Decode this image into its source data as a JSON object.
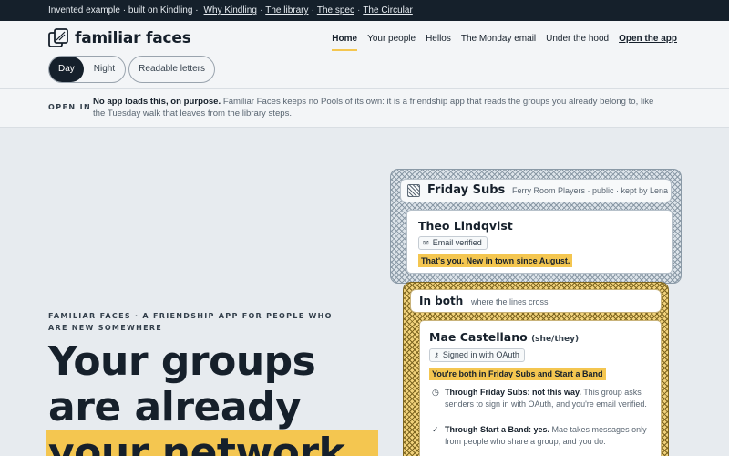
{
  "topbar": {
    "lead": "Invented example · built on Kindling ·",
    "links": [
      "Why Kindling",
      "The library",
      "The spec",
      "The Circular"
    ],
    "separator": "·"
  },
  "brand": {
    "name": "familiar faces",
    "logo_icon": "two-overlapping-cards-icon"
  },
  "nav": {
    "items": [
      "Home",
      "Your people",
      "Hellos",
      "The Monday email",
      "Under the hood"
    ],
    "active": "Home",
    "cta": "Open the app"
  },
  "theme": {
    "options": [
      "Day",
      "Night"
    ],
    "selected": "Day",
    "readable_label": "Readable letters"
  },
  "notice": {
    "label": "OPEN IN",
    "strong": "No app loads this, on purpose.",
    "text": "Familiar Faces keeps no Pools of its own: it is a friendship app that reads the groups you already belong to, like the Tuesday walk that leaves from the library steps."
  },
  "hero": {
    "kicker": "Familiar Faces · a friendship app for people who are new somewhere",
    "headline_lines": [
      "Your groups",
      "are already"
    ],
    "headline_highlight": "your network."
  },
  "group_card": {
    "title": "Friday Subs",
    "subtitle": "Ferry Room Players · public · kept by Lena",
    "person": {
      "name": "Theo Lindqvist",
      "chip_icon": "envelope-icon",
      "chip_label": "Email verified",
      "tag": "That's you. New in town since August."
    }
  },
  "both_card": {
    "title": "In both",
    "subtitle": "where the lines cross",
    "person": {
      "name": "Mae Castellano",
      "pronouns": "(she/they)",
      "chip_icon": "key-icon",
      "chip_label": "Signed in with OAuth",
      "tag": "You're both in Friday Subs and Start a Band"
    },
    "reasons": [
      {
        "icon": "clock-icon",
        "strong": "Through Friday Subs: not this way.",
        "text": "This group asks senders to sign in with OAuth, and you're email verified."
      },
      {
        "icon": "check-icon",
        "strong": "Through Start a Band: yes.",
        "text": "Mae takes messages only from people who share a group, and you do."
      }
    ]
  },
  "colors": {
    "dark": "#15202b",
    "accent": "#f4c650",
    "page": "#e7ebef"
  }
}
